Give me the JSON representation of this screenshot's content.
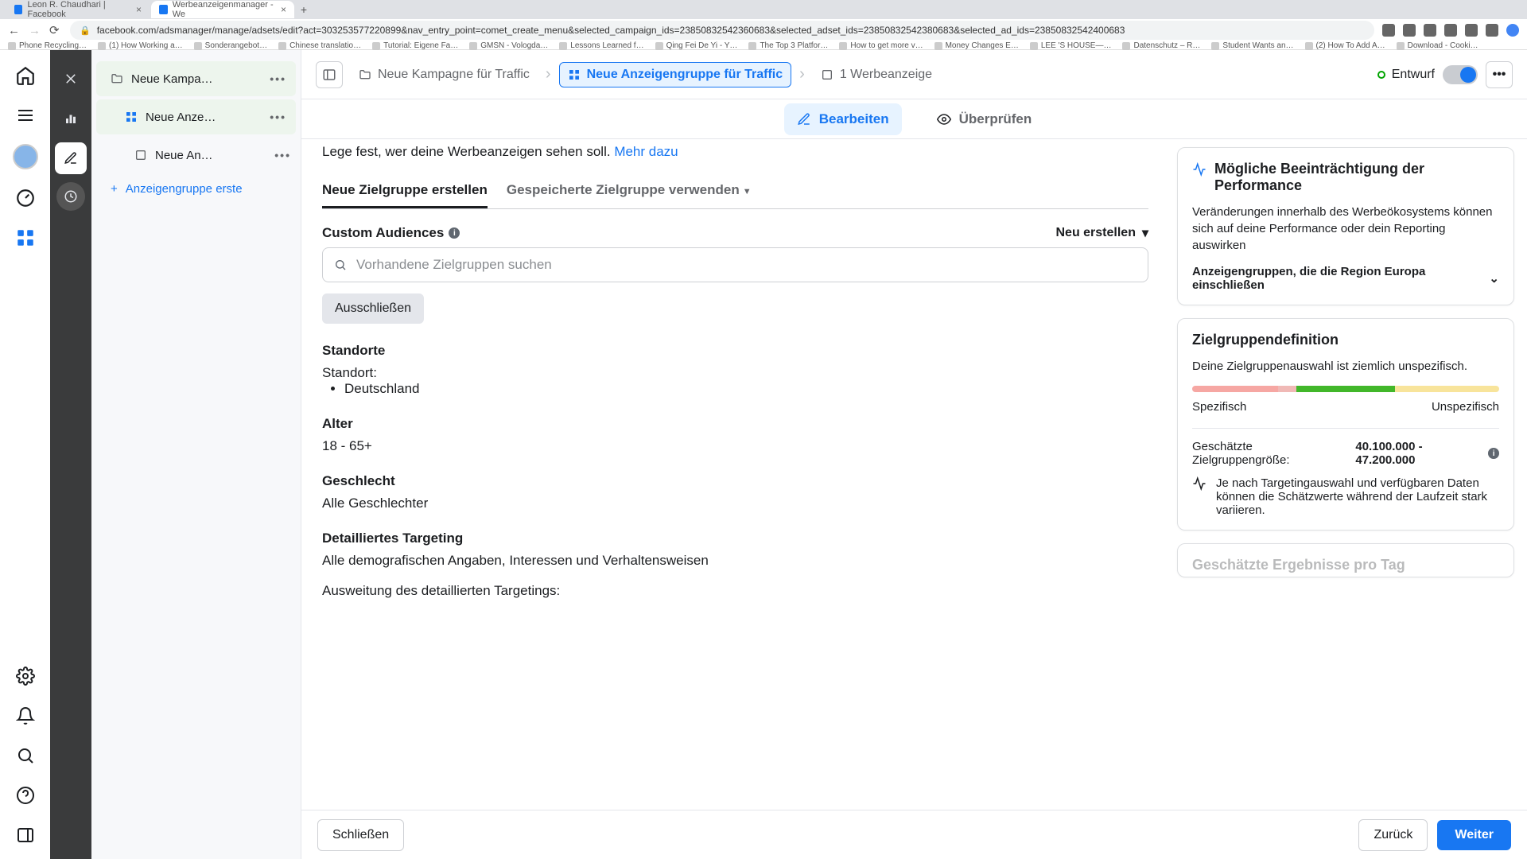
{
  "browser": {
    "tabs": [
      {
        "title": "Leon R. Chaudhari | Facebook"
      },
      {
        "title": "Werbeanzeigenmanager - We"
      }
    ],
    "url": "facebook.com/adsmanager/manage/adsets/edit?act=303253577220899&nav_entry_point=comet_create_menu&selected_campaign_ids=23850832542360683&selected_adset_ids=23850832542380683&selected_ad_ids=23850832542400683",
    "bookmarks": [
      "Phone Recycling…",
      "(1) How Working a…",
      "Sonderangebot…",
      "Chinese translatio…",
      "Tutorial: Eigene Fa…",
      "GMSN - Vologda…",
      "Lessons Learned f…",
      "Qing Fei De Yi - Y…",
      "The Top 3 Platfor…",
      "How to get more v…",
      "Money Changes E…",
      "LEE 'S HOUSE—…",
      "Datenschutz – R…",
      "Student Wants an…",
      "(2) How To Add A…",
      "Download - Cooki…"
    ]
  },
  "tree": {
    "item1": "Neue Kampa…",
    "item2": "Neue Anze…",
    "item3": "Neue An…",
    "add": "Anzeigengruppe erste"
  },
  "header": {
    "crumb1": "Neue Kampagne für Traffic",
    "crumb2": "Neue Anzeigengruppe für Traffic",
    "crumb3": "1 Werbeanzeige",
    "draft": "Entwurf",
    "tab_edit": "Bearbeiten",
    "tab_review": "Überprüfen"
  },
  "form": {
    "intro_text": "Lege fest, wer deine Werbeanzeigen sehen soll. ",
    "intro_link": "Mehr dazu",
    "subtab_new": "Neue Zielgruppe erstellen",
    "subtab_saved": "Gespeicherte Zielgruppe verwenden",
    "ca_label": "Custom Audiences",
    "neu_erstellen": "Neu erstellen",
    "search_placeholder": "Vorhandene Zielgruppen suchen",
    "exclude_btn": "Ausschließen",
    "locations_title": "Standorte",
    "location_label": "Standort:",
    "location_value": "Deutschland",
    "age_title": "Alter",
    "age_value": "18 - 65+",
    "gender_title": "Geschlecht",
    "gender_value": "Alle Geschlechter",
    "detail_title": "Detailliertes Targeting",
    "detail_value": "Alle demografischen Angaben, Interessen und Verhaltensweisen",
    "expansion": "Ausweitung des detaillierten Targetings:"
  },
  "cards": {
    "perf_title": "Mögliche Beeinträchtigung der Performance",
    "perf_body": "Veränderungen innerhalb des Werbeökosystems können sich auf deine Performance oder dein Reporting auswirken",
    "perf_collapser": "Anzeigengruppen, die die Region Europa einschließen",
    "aud_title": "Zielgruppendefinition",
    "aud_sub": "Deine Zielgruppenauswahl ist ziemlich unspezifisch.",
    "spec": "Spezifisch",
    "unspec": "Unspezifisch",
    "est_label": "Geschätzte Zielgruppengröße: ",
    "est_value": "40.100.000 - 47.200.000",
    "note": "Je nach Targetingauswahl und verfügbaren Daten können die Schätzwerte während der Laufzeit stark variieren."
  },
  "footer": {
    "close": "Schließen",
    "back": "Zurück",
    "next": "Weiter"
  }
}
